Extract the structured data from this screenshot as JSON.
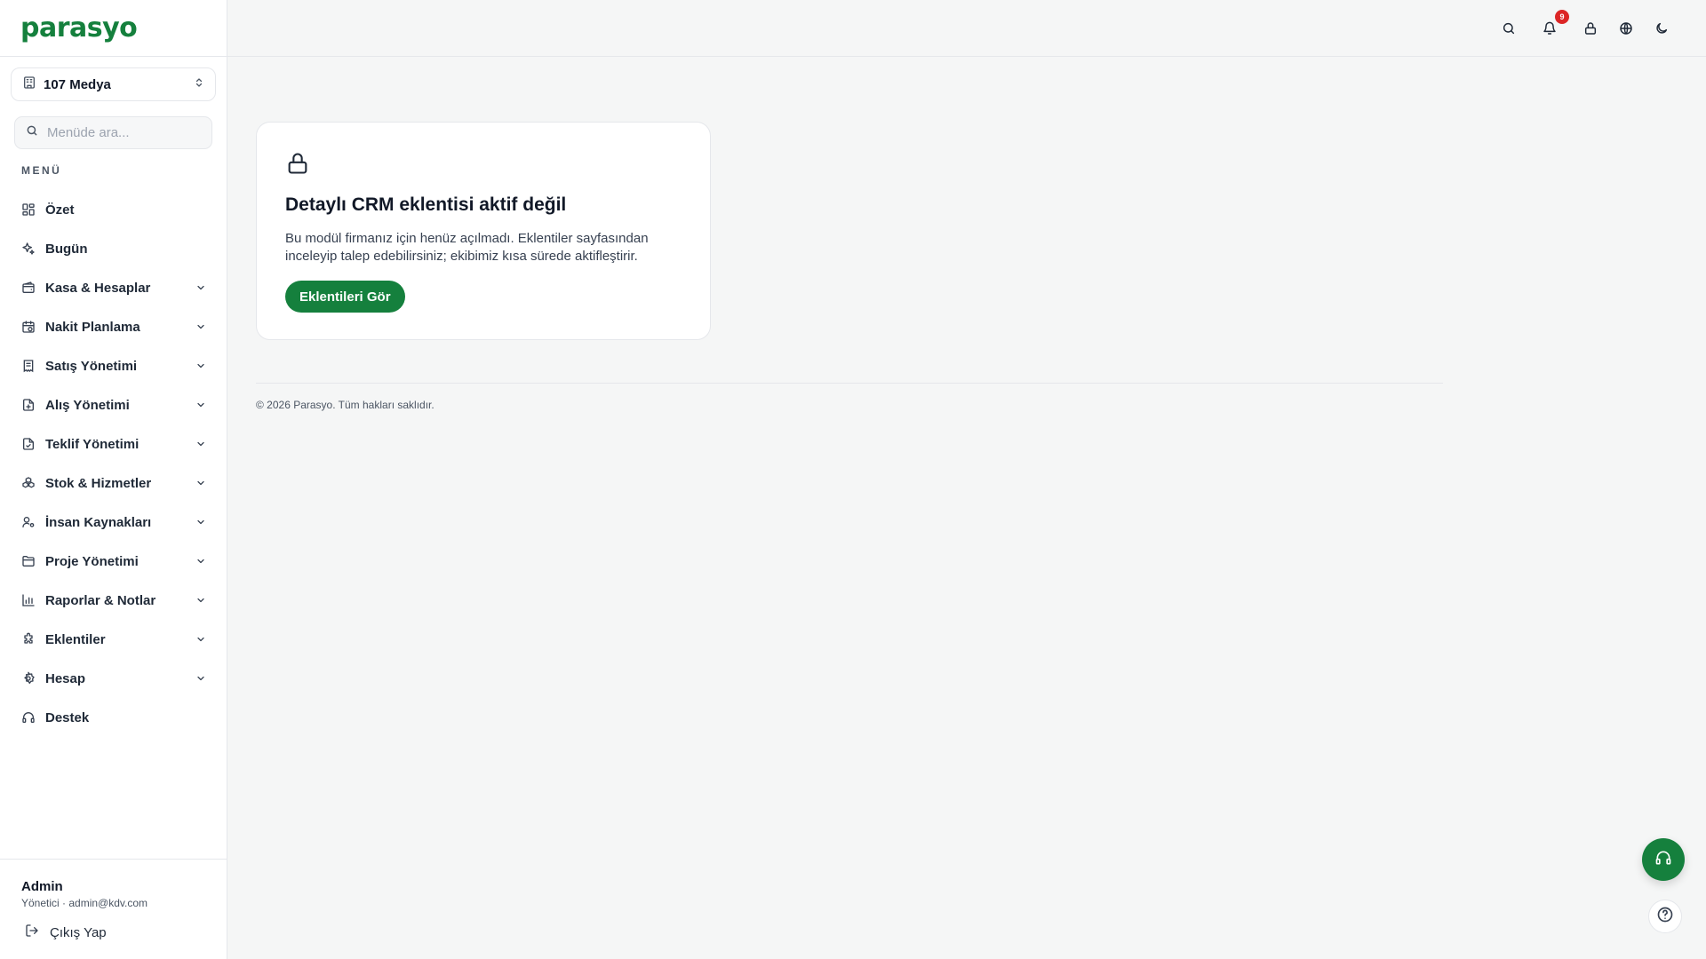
{
  "brand": {
    "name": "parasyo",
    "color": "#15803d"
  },
  "company": {
    "name": "107 Medya",
    "icon": "building-icon",
    "toggle_icon": "chevrons-up-down-icon"
  },
  "search": {
    "placeholder": "Menüde ara...",
    "value": ""
  },
  "menu": {
    "title": "MENÜ",
    "items": [
      {
        "label": "Özet",
        "icon": "dashboard-grid-icon",
        "expandable": false
      },
      {
        "label": "Bugün",
        "icon": "sparkles-icon",
        "expandable": false
      },
      {
        "label": "Kasa & Hesaplar",
        "icon": "wallet-icon",
        "expandable": true
      },
      {
        "label": "Nakit Planlama",
        "icon": "calendar-clock-icon",
        "expandable": true
      },
      {
        "label": "Satış Yönetimi",
        "icon": "receipt-icon",
        "expandable": true
      },
      {
        "label": "Alış Yönetimi",
        "icon": "file-plus-icon",
        "expandable": true
      },
      {
        "label": "Teklif Yönetimi",
        "icon": "file-check-icon",
        "expandable": true
      },
      {
        "label": "Stok & Hizmetler",
        "icon": "boxes-icon",
        "expandable": true
      },
      {
        "label": "İnsan Kaynakları",
        "icon": "user-cog-icon",
        "expandable": true
      },
      {
        "label": "Proje Yönetimi",
        "icon": "folder-icon",
        "expandable": true
      },
      {
        "label": "Raporlar & Notlar",
        "icon": "bar-chart-icon",
        "expandable": true
      },
      {
        "label": "Eklentiler",
        "icon": "puzzle-icon",
        "expandable": true
      },
      {
        "label": "Hesap",
        "icon": "gear-icon",
        "expandable": true
      },
      {
        "label": "Destek",
        "icon": "headset-icon",
        "expandable": false
      }
    ]
  },
  "user": {
    "name": "Admin",
    "meta": "Yönetici · admin@kdv.com"
  },
  "logout": {
    "label": "Çıkış Yap"
  },
  "topbar": {
    "icons": [
      "search-icon",
      "bell-icon",
      "lock-icon",
      "globe-icon",
      "moon-icon"
    ],
    "notification_count": "9"
  },
  "locked_card": {
    "icon": "lock-icon",
    "title": "Detaylı CRM eklentisi aktif değil",
    "description": "Bu modül firmanız için henüz açılmadı. Eklentiler sayfasından inceleyip talep edebilirsiniz; ekibimiz kısa sürede aktifleştirir.",
    "button_label": "Eklentileri Gör"
  },
  "footer": {
    "text": "© 2026 Parasyo. Tüm hakları saklıdır."
  },
  "colors": {
    "accent": "#15803d",
    "badge": "#dc2626",
    "background": "#f5f6f6"
  }
}
